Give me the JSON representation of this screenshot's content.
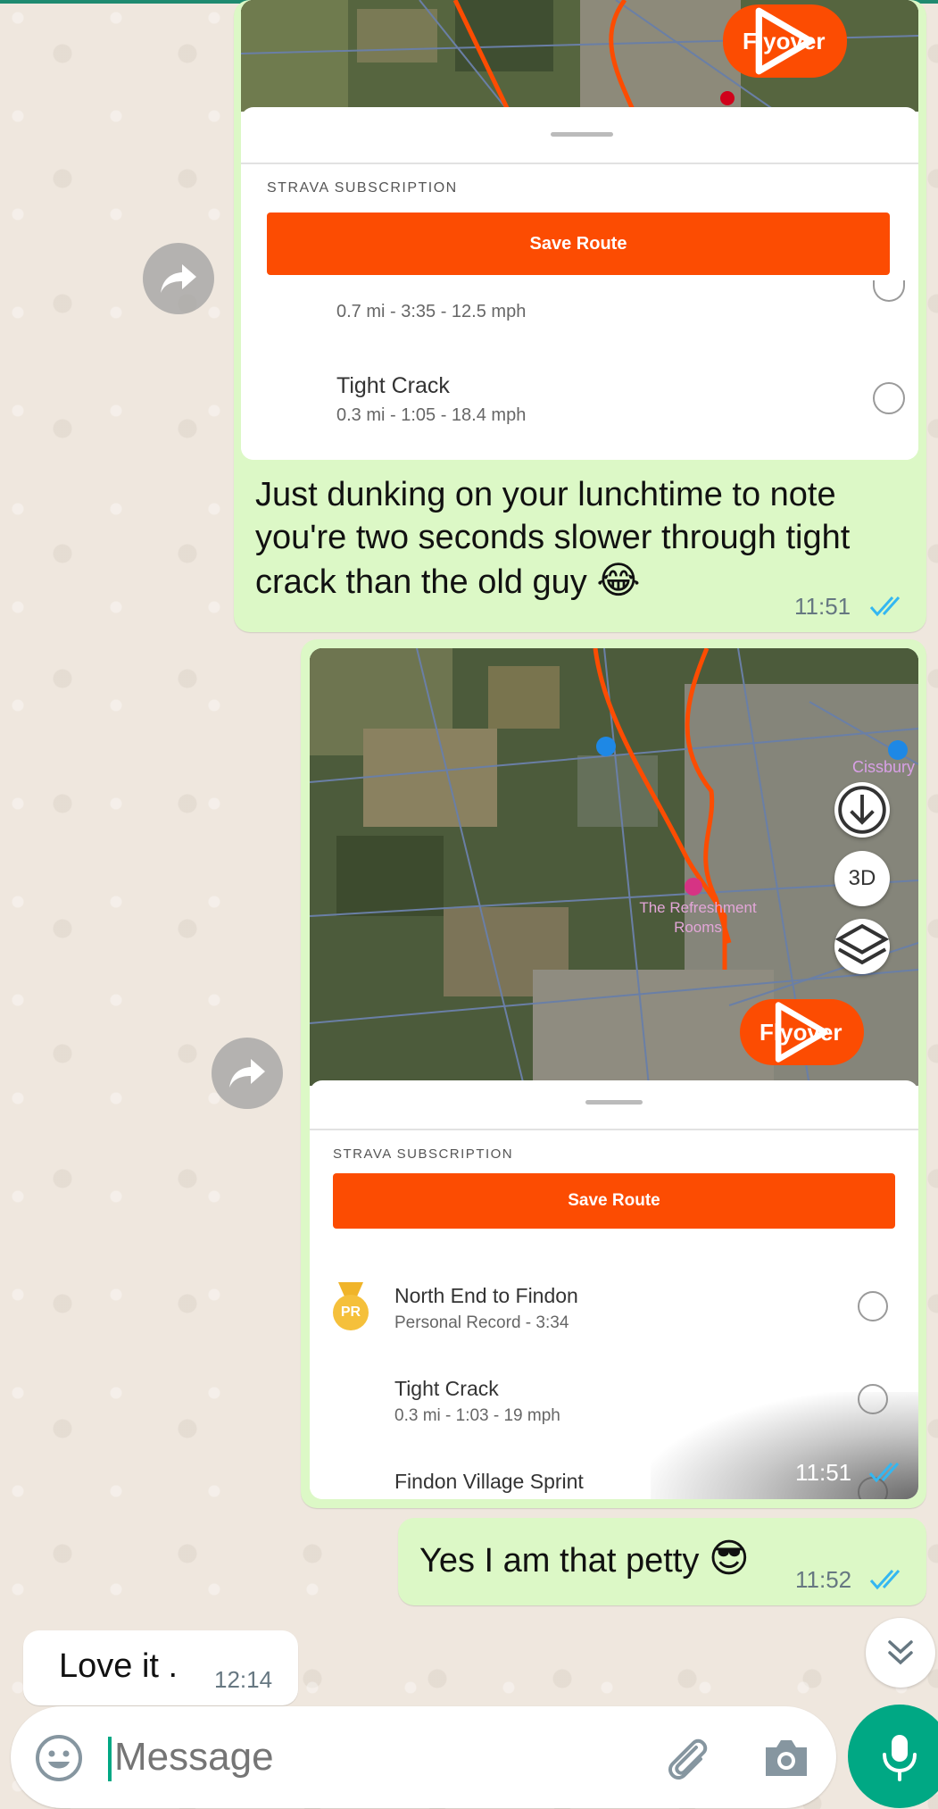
{
  "colors": {
    "outgoing_bubble": "#dcf8c6",
    "incoming_bubble": "#ffffff",
    "strava_orange": "#fc4c02",
    "read_ticks": "#34b7f1",
    "whatsapp_green": "#00a884"
  },
  "messages": [
    {
      "type": "image",
      "direction": "outgoing",
      "screenshot": {
        "flyover_label": "Flyover",
        "subscription_label": "STRAVA SUBSCRIPTION",
        "save_route_label": "Save Route",
        "segments": [
          {
            "title": "",
            "sub": "0.7 mi - 3:35 - 12.5 mph"
          },
          {
            "title": "Tight Crack",
            "sub": "0.3 mi - 1:05 - 18.4 mph"
          }
        ]
      },
      "caption": "Just dunking on your lunchtime to note you're two seconds slower through tight crack than the old guy",
      "emoji": "😂",
      "time": "11:51",
      "status_icon": "double-check-read-icon"
    },
    {
      "type": "image",
      "direction": "outgoing",
      "screenshot": {
        "map_label_cissbury": "Cissbury",
        "map_label_poi": "The Refreshment Rooms",
        "button_3d": "3D",
        "flyover_label": "Flyover",
        "subscription_label": "STRAVA SUBSCRIPTION",
        "save_route_label": "Save Route",
        "segments": [
          {
            "title": "North End to Findon",
            "sub": "Personal Record - 3:34",
            "badge": "PR"
          },
          {
            "title": "Tight Crack",
            "sub": "0.3 mi - 1:03 - 19 mph"
          },
          {
            "title": "Findon Village Sprint",
            "sub": ""
          }
        ]
      },
      "time": "11:51",
      "status_icon": "double-check-read-icon"
    },
    {
      "type": "text",
      "direction": "outgoing",
      "text": "Yes I am that petty",
      "emoji": "😎",
      "time": "11:52",
      "status_icon": "double-check-read-icon"
    },
    {
      "type": "text",
      "direction": "incoming",
      "text": "Love it .",
      "time": "12:14"
    }
  ],
  "composer": {
    "placeholder": "Message",
    "emoji_icon": "emoji-icon",
    "attach_icon": "paperclip-icon",
    "camera_icon": "camera-icon",
    "mic_icon": "mic-icon"
  }
}
